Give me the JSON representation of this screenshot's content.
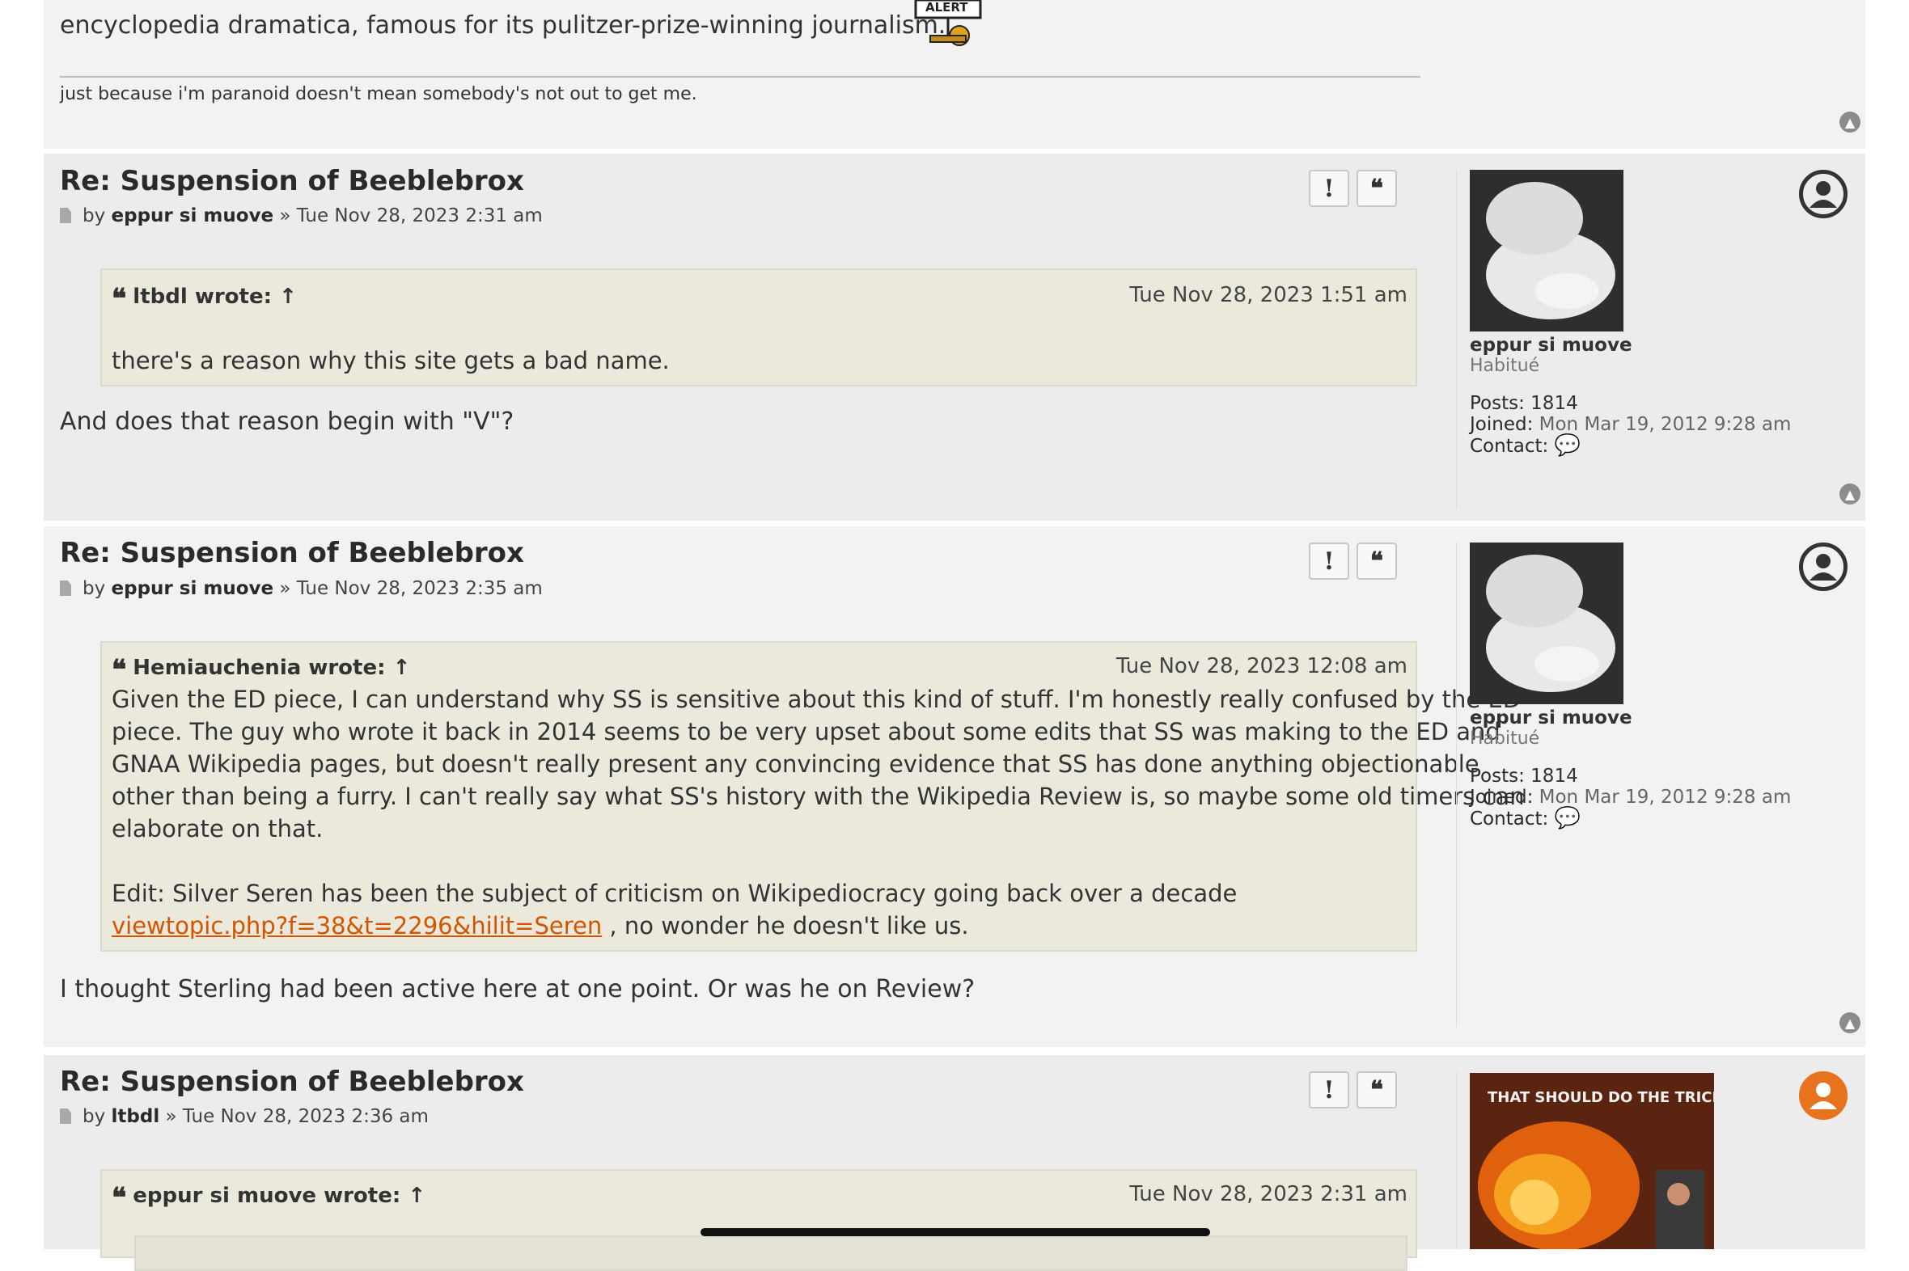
{
  "top_post": {
    "signature_top": "encyclopedia dramatica, famous for its pulitzer-prize-winning journalism.",
    "alert_badge": "ALERT",
    "signature_bottom": "just because i'm paranoid doesn't mean somebody's not out to get me."
  },
  "posts": [
    {
      "title": "Re: Suspension of Beeblebrox",
      "by": "by",
      "author": "eppur si muove",
      "date": "» Tue Nov 28, 2023 2:31 am",
      "quote": {
        "author": "ltbdl wrote:",
        "arrow": "↑",
        "date": "Tue Nov 28, 2023 1:51 am",
        "text": "there's a reason why this site gets a bad name."
      },
      "body": "And does that reason begin with \"V\"?",
      "profile": {
        "username": "eppur si muove",
        "rank": "Habitué",
        "posts_label": "Posts:",
        "posts_value": "1814",
        "joined_label": "Joined:",
        "joined_value": "Mon Mar 19, 2012 9:28 am",
        "contact_label": "Contact:"
      }
    },
    {
      "title": "Re: Suspension of Beeblebrox",
      "by": "by",
      "author": "eppur si muove",
      "date": "» Tue Nov 28, 2023 2:35 am",
      "quote": {
        "author": "Hemiauchenia wrote:",
        "arrow": "↑",
        "date": "Tue Nov 28, 2023 12:08 am",
        "line1": "Given the ED piece, I can understand why SS is sensitive about this kind of stuff. I'm honestly really confused by the ED",
        "line2": "piece. The guy who wrote it back in 2014 seems to be very upset about some edits that SS was making to the ED and",
        "line3": "GNAA Wikipedia pages, but doesn't really present any convincing evidence that SS has done anything objectionable",
        "line4": "other than being a furry. I can't really say what SS's history with the Wikipedia Review is, so maybe some old timers can",
        "line5": "elaborate on that.",
        "edit": "Edit: Silver Seren has been the subject of criticism on Wikipediocracy going back over a decade",
        "link": "viewtopic.php?f=38&t=2296&hilit=Seren",
        "after_link": ", no wonder he doesn't like us."
      },
      "body": "I thought Sterling had been active here at one point. Or was he on Review?",
      "profile": {
        "username": "eppur si muove",
        "rank": "Habitué",
        "posts_label": "Posts:",
        "posts_value": "1814",
        "joined_label": "Joined:",
        "joined_value": "Mon Mar 19, 2012 9:28 am",
        "contact_label": "Contact:"
      }
    },
    {
      "title": "Re: Suspension of Beeblebrox",
      "by": "by",
      "author": "ltbdl",
      "date": "» Tue Nov 28, 2023 2:36 am",
      "quote": {
        "author": "eppur si muove wrote:",
        "arrow": "↑",
        "date": "Tue Nov 28, 2023 2:31 am"
      },
      "avatar_caption": "THAT SHOULD DO THE TRICK"
    }
  ],
  "buttons": {
    "report": "!",
    "quote": "66"
  },
  "colors": {
    "link": "#d45500",
    "online_status": "#e8731e",
    "offline_status": "#333333"
  }
}
